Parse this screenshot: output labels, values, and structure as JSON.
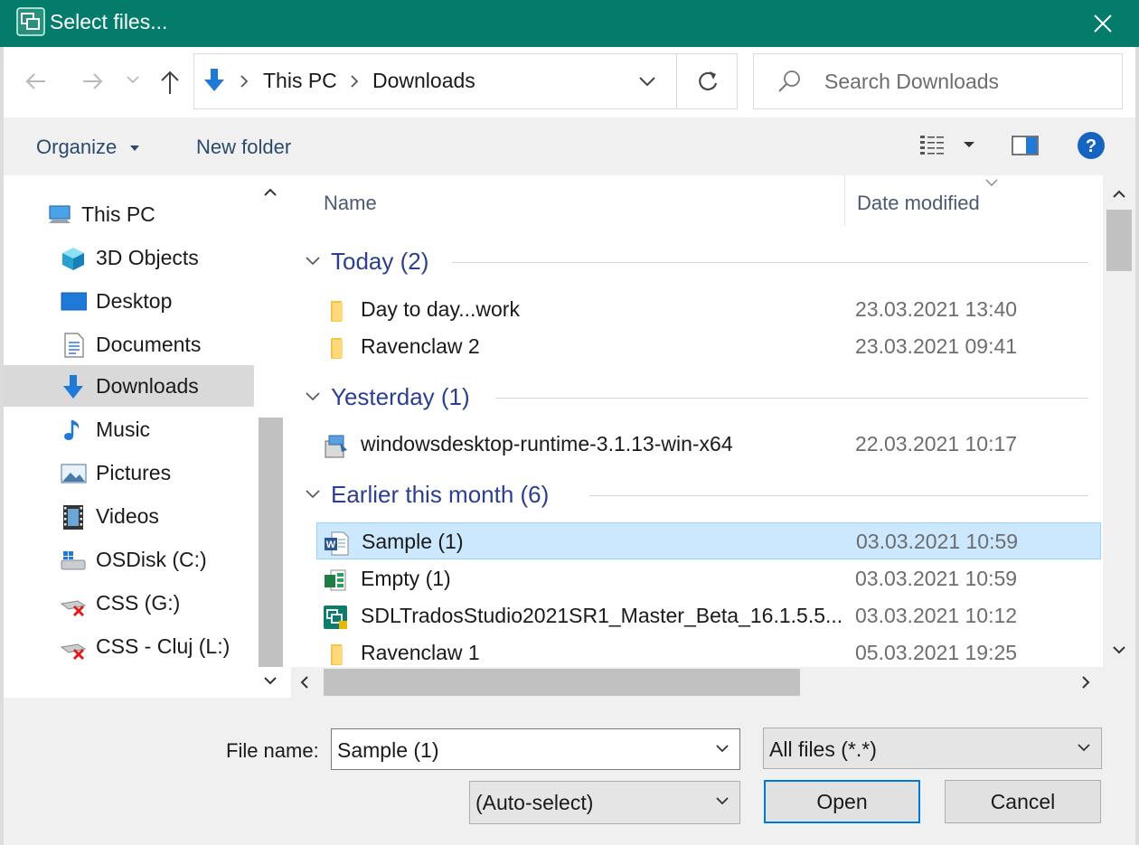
{
  "window": {
    "title": "Select files..."
  },
  "nav": {
    "breadcrumb": [
      "This PC",
      "Downloads"
    ],
    "search_placeholder": "Search Downloads"
  },
  "toolbar": {
    "organize": "Organize",
    "new_folder": "New folder"
  },
  "sidebar": {
    "items": [
      {
        "label": "This PC",
        "icon": "computer-icon"
      },
      {
        "label": "3D Objects",
        "icon": "cube-icon"
      },
      {
        "label": "Desktop",
        "icon": "desktop-icon"
      },
      {
        "label": "Documents",
        "icon": "document-icon"
      },
      {
        "label": "Downloads",
        "icon": "download-icon",
        "selected": true
      },
      {
        "label": "Music",
        "icon": "music-icon"
      },
      {
        "label": "Pictures",
        "icon": "picture-icon"
      },
      {
        "label": "Videos",
        "icon": "video-icon"
      },
      {
        "label": "OSDisk (C:)",
        "icon": "drive-icon"
      },
      {
        "label": "CSS (G:)",
        "icon": "network-drive-disconnected-icon"
      },
      {
        "label": "CSS - Cluj (L:)",
        "icon": "network-drive-disconnected-icon"
      }
    ]
  },
  "files": {
    "columns": {
      "name": "Name",
      "date": "Date modified"
    },
    "groups": [
      {
        "title": "Today (2)",
        "items": [
          {
            "name": "Day to day...work",
            "date": "23.03.2021 13:40",
            "icon": "folder-icon"
          },
          {
            "name": "Ravenclaw 2",
            "date": "23.03.2021 09:41",
            "icon": "folder-icon"
          }
        ]
      },
      {
        "title": "Yesterday (1)",
        "items": [
          {
            "name": "windowsdesktop-runtime-3.1.13-win-x64",
            "date": "22.03.2021 10:17",
            "icon": "installer-icon"
          }
        ]
      },
      {
        "title": "Earlier this month (6)",
        "items": [
          {
            "name": "Sample (1)",
            "date": "03.03.2021 10:59",
            "icon": "word-document-icon",
            "selected": true
          },
          {
            "name": "Empty (1)",
            "date": "03.03.2021 10:59",
            "icon": "spreadsheet-icon"
          },
          {
            "name": "SDLTradosStudio2021SR1_Master_Beta_16.1.5.5...",
            "date": "03.03.2021 10:12",
            "icon": "trados-app-icon"
          },
          {
            "name": "Ravenclaw 1",
            "date": "05.03.2021 19:25",
            "icon": "folder-icon"
          }
        ]
      }
    ]
  },
  "footer": {
    "file_name_label": "File name:",
    "file_name_value": "Sample (1)",
    "filter": "All files (*.*)",
    "encoding": "(Auto-select)",
    "open": "Open",
    "cancel": "Cancel"
  },
  "colors": {
    "titlebar": "#047c6b",
    "selection": "#cce8ff",
    "group_heading": "#2b3f8e",
    "accent": "#0078d7"
  }
}
